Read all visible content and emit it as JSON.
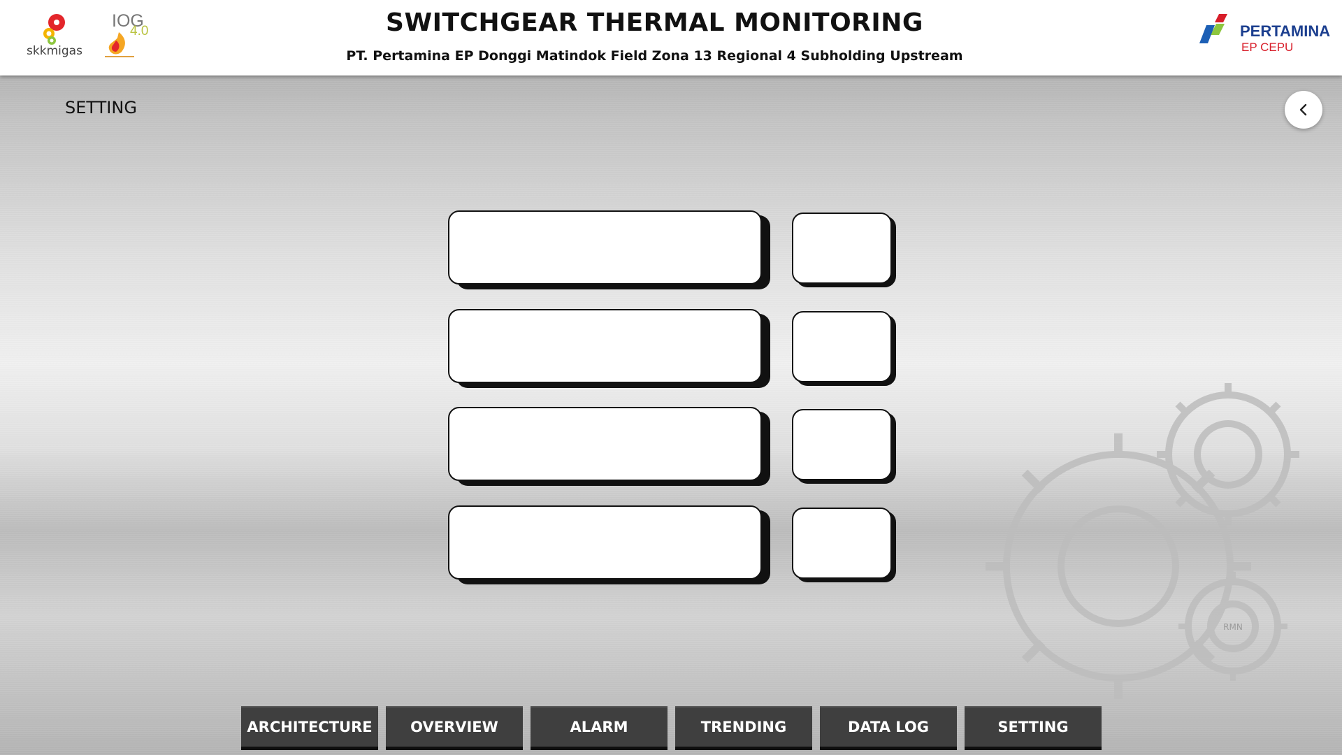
{
  "header": {
    "title": "SWITCHGEAR THERMAL MONITORING",
    "subtitle": "PT. Pertamina EP Donggi Matindok Field Zona 13 Regional 4 Subholding Upstream",
    "logos": {
      "left_primary": "skkmigas",
      "left_secondary": {
        "line1": "IOG",
        "line2": "4.0"
      },
      "right": {
        "name": "PERTAMINA",
        "unit": "EP CEPU"
      }
    }
  },
  "page": {
    "label": "SETTING",
    "back_icon": "chevron-left-icon"
  },
  "setting_rows": [
    {
      "field_value": "",
      "small_value": ""
    },
    {
      "field_value": "",
      "small_value": ""
    },
    {
      "field_value": "",
      "small_value": ""
    },
    {
      "field_value": "",
      "small_value": ""
    }
  ],
  "decoration": {
    "gear_icon": "gears-icon",
    "watermark": "RMN"
  },
  "nav": {
    "items": [
      "ARCHITECTURE",
      "OVERVIEW",
      "ALARM",
      "TRENDING",
      "DATA LOG",
      "SETTING"
    ]
  },
  "colors": {
    "header_bg": "#ffffff",
    "nav_bg": "#3f3f3f",
    "pertamina_blue": "#1c3f8f",
    "pertamina_red": "#d81e2a",
    "pertamina_green": "#8dc63f"
  }
}
